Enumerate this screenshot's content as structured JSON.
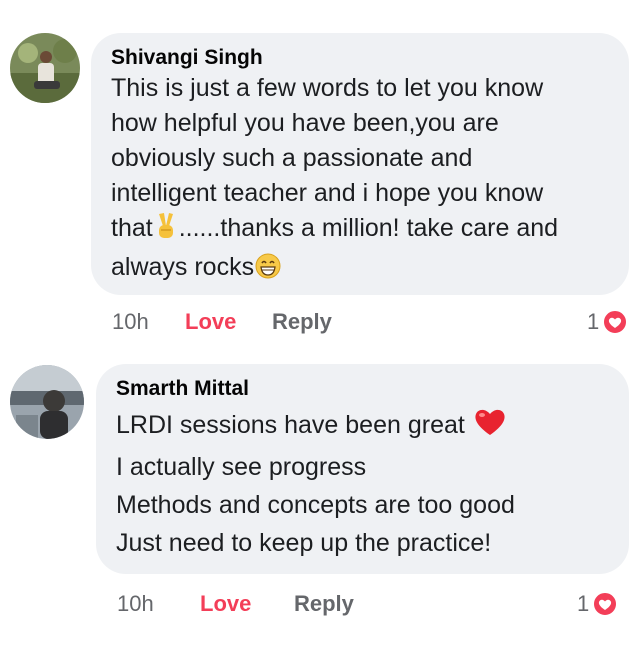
{
  "comments": [
    {
      "author": "Shivangi Singh",
      "lines": [
        "This is just a few words to let you know",
        "how helpful you have been,you are",
        "obviously such a passionate and",
        "intelligent teacher and i hope you know"
      ],
      "line5_before": "that",
      "line5_after": "......thanks a million! take care and",
      "line6": "always rocks",
      "time": "10h",
      "love": "Love",
      "reply": "Reply",
      "reaction_count": "1"
    },
    {
      "author": "Smarth Mittal",
      "line1": "LRDI sessions have been great",
      "lines": [
        "I actually see progress",
        "Methods and concepts are too good",
        "Just need to keep up the practice!"
      ],
      "time": "10h",
      "love": "Love",
      "reply": "Reply",
      "reaction_count": "1"
    }
  ],
  "icons": {
    "victory": "victory-hand-icon",
    "grin": "grinning-face-icon",
    "heart": "red-heart-icon",
    "reaction": "love-reaction-icon"
  },
  "colors": {
    "bubble": "#eff1f4",
    "love": "#f33e58",
    "muted": "#65676b"
  }
}
